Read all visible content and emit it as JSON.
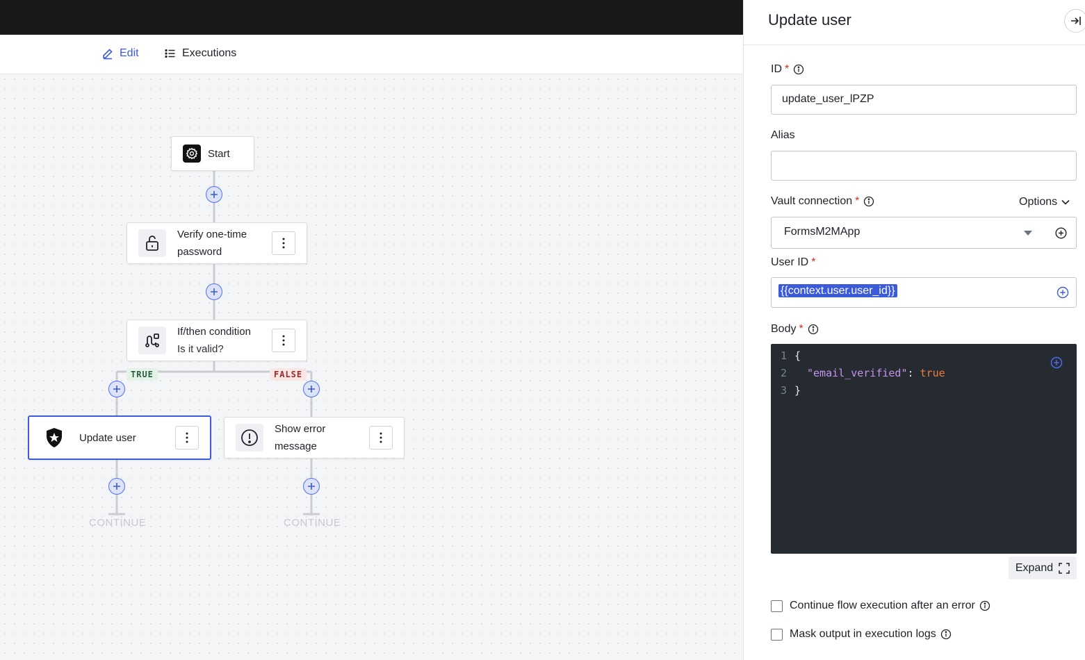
{
  "tabs": {
    "edit": "Edit",
    "executions": "Executions"
  },
  "flow": {
    "start": "Start",
    "verify_line1": "Verify one-time",
    "verify_line2": "password",
    "condition_title": "If/then condition",
    "condition_sub": "Is it valid?",
    "true_badge": "TRUE",
    "false_badge": "FALSE",
    "update_user": "Update user",
    "error_line1": "Show error",
    "error_line2": "message",
    "continue_left": "CONTINUE",
    "continue_right": "CONTINUE"
  },
  "panel": {
    "title": "Update user",
    "id_label": "ID",
    "id_value": "update_user_lPZP",
    "alias_label": "Alias",
    "alias_value": "",
    "vault_label": "Vault connection",
    "options_label": "Options",
    "vault_value": "FormsM2MApp",
    "userid_label": "User ID",
    "userid_value": "{{context.user.user_id}}",
    "body_label": "Body",
    "code_lines": {
      "n1": "1",
      "n2": "2",
      "n3": "3",
      "open": "{",
      "key": "\"email_verified\"",
      "colon": ": ",
      "val": "true",
      "close": "}"
    },
    "expand_label": "Expand",
    "continue_after_error": "Continue flow execution after an error",
    "mask_output": "Mask output in execution logs"
  },
  "colors": {
    "accent": "#3b5bdb",
    "topbar": "#191919",
    "required": "#d92d20",
    "code_bg": "#262b31"
  }
}
